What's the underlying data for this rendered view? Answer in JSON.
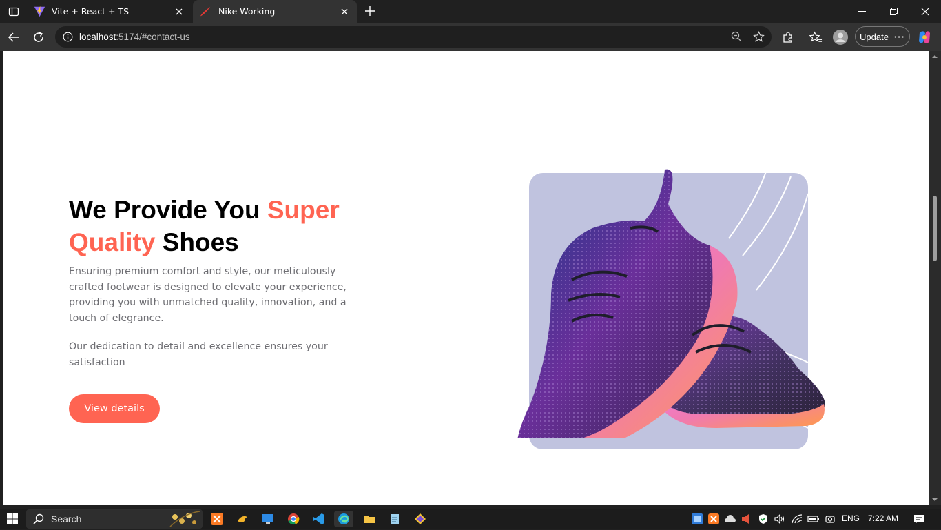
{
  "browser": {
    "tabs": [
      {
        "title": "Vite + React + TS",
        "active": false,
        "icon": "vite-logo-icon"
      },
      {
        "title": "Nike Working",
        "active": true,
        "icon": "nike-swoosh-icon"
      }
    ],
    "url_host": "localhost",
    "url_path": ":5174/#contact-us",
    "update_label": "Update"
  },
  "page": {
    "heading_part1": "We Provide You ",
    "heading_accent1": "Super",
    "heading_accent2": "Quality",
    "heading_part2": " Shoes",
    "paragraph1": "Ensuring premium comfort and style, our meticulously crafted footwear is designed to elevate your experience, providing you with unmatched quality, innovation, and a touch of elegrance.",
    "paragraph2": "Our dedication to detail and excellence ensures your satisfaction",
    "cta_label": "View details",
    "accent_color": "#ff6452",
    "card_color": "#c0c3df"
  },
  "taskbar": {
    "search_label": "Search",
    "language": "ENG",
    "time": "7:22 AM"
  }
}
